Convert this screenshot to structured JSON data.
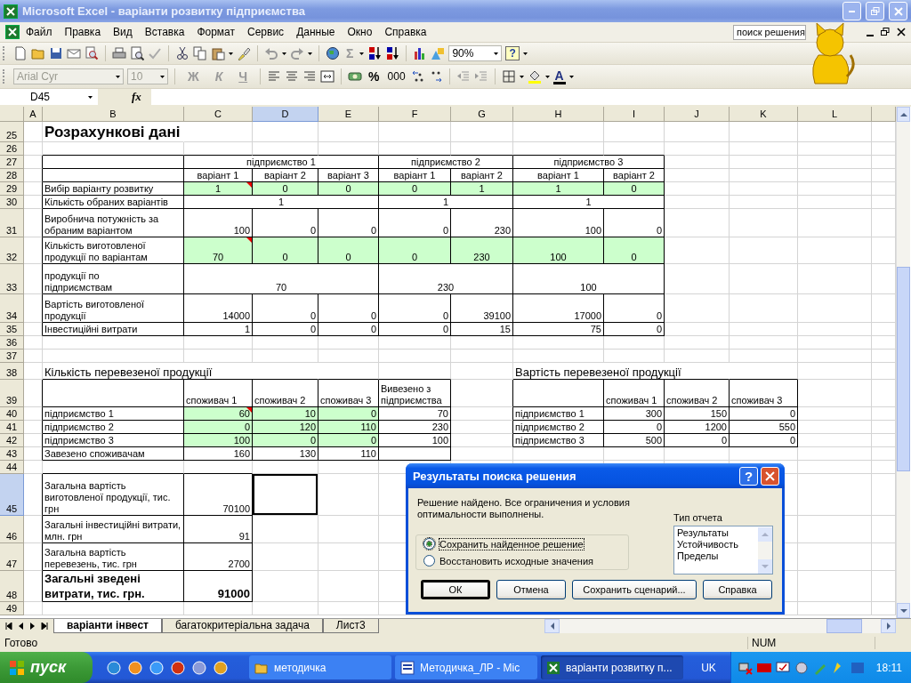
{
  "window": {
    "title": "Microsoft Excel - варіанти розвитку підприємства"
  },
  "menu": [
    "Файл",
    "Правка",
    "Вид",
    "Вставка",
    "Формат",
    "Сервис",
    "Данные",
    "Окно",
    "Справка"
  ],
  "help_search": {
    "value": "поиск решения"
  },
  "toolbar_standard": {
    "sum": "Σ",
    "zoom": "90%",
    "help": "?"
  },
  "toolbar_formatting": {
    "font": "Arial Cyr",
    "size": "10",
    "style_buttons": [
      "Ж",
      "К",
      "Ч"
    ],
    "percent": "%",
    "thousands": "000",
    "font_color": "A"
  },
  "formula_bar": {
    "name_box": "D45",
    "function_label": "fx"
  },
  "sheet": {
    "columns": [
      {
        "label": "A",
        "selected": false
      },
      {
        "label": "B",
        "selected": false
      },
      {
        "label": "C",
        "selected": false
      },
      {
        "label": "D",
        "selected": true
      },
      {
        "label": "E",
        "selected": false
      },
      {
        "label": "F",
        "selected": false
      },
      {
        "label": "G",
        "selected": false
      },
      {
        "label": "H",
        "selected": false
      },
      {
        "label": "I",
        "selected": false
      },
      {
        "label": "J",
        "selected": false
      },
      {
        "label": "K",
        "selected": false
      },
      {
        "label": "L",
        "selected": false
      }
    ],
    "rows": [
      {
        "number": "25",
        "selected": false,
        "cells": [
          {
            "kind": "title",
            "text": "Розрахункові дані"
          }
        ]
      },
      {
        "number": "26",
        "selected": false
      },
      {
        "number": "27",
        "selected": false,
        "cells": [
          {
            "kind": "centered",
            "text": "підприємство 1"
          },
          {
            "kind": "centered",
            "text": "підприємство 2"
          },
          {
            "kind": "centered",
            "text": "підприємство 3"
          }
        ]
      },
      {
        "number": "28",
        "selected": false,
        "cells": [
          {
            "kind": "centered",
            "text": "варіант 1"
          },
          {
            "kind": "centered",
            "text": "варіант 2"
          },
          {
            "kind": "centered",
            "text": "варіант 3"
          },
          {
            "kind": "centered",
            "text": "варіант 1"
          },
          {
            "kind": "centered",
            "text": "варіант 2"
          },
          {
            "kind": "centered",
            "text": "варіант 1"
          },
          {
            "kind": "centered",
            "text": "варіант 2"
          }
        ]
      },
      {
        "number": "29",
        "selected": false,
        "cells": [
          {
            "kind": "label",
            "text": "Вибір варіанту розвитку"
          },
          {
            "kind": "centered",
            "color": "#ccffcc",
            "comment": true,
            "text": "1"
          },
          {
            "kind": "centered",
            "color": "#ccffcc",
            "text": "0"
          },
          {
            "kind": "centered",
            "color": "#ccffcc",
            "text": "0"
          },
          {
            "kind": "centered",
            "color": "#ccffcc",
            "text": "0"
          },
          {
            "kind": "centered",
            "color": "#ccffcc",
            "text": "1"
          },
          {
            "kind": "centered",
            "color": "#ccffcc",
            "text": "1"
          },
          {
            "kind": "centered",
            "color": "#ccffcc",
            "text": "0"
          }
        ]
      },
      {
        "number": "30",
        "selected": false,
        "cells": [
          {
            "kind": "label",
            "text": "Кількість обраних варіантів"
          },
          {
            "kind": "centered",
            "text": "1"
          },
          {
            "kind": "centered",
            "text": "1"
          },
          {
            "kind": "centered",
            "text": "1"
          }
        ]
      },
      {
        "number": "31",
        "selected": false,
        "cells": [
          {
            "kind": "wrapped_label",
            "text": "Виробнича потужність за обраним варіантом"
          },
          {
            "kind": "number",
            "text": "100"
          },
          {
            "kind": "number",
            "text": "0"
          },
          {
            "kind": "number",
            "text": "0"
          },
          {
            "kind": "number",
            "text": "0"
          },
          {
            "kind": "number",
            "text": "230"
          },
          {
            "kind": "number",
            "text": "100"
          },
          {
            "kind": "number",
            "text": "0"
          }
        ]
      },
      {
        "number": "32",
        "selected": false,
        "cells": [
          {
            "kind": "wrapped_label",
            "text": "Кількість виготовленої продукції по варіантам"
          },
          {
            "kind": "centered",
            "color": "#ccffcc",
            "comment": true,
            "text": "70"
          },
          {
            "kind": "centered",
            "color": "#ccffcc",
            "text": "0"
          },
          {
            "kind": "centered",
            "color": "#ccffcc",
            "text": "0"
          },
          {
            "kind": "centered",
            "color": "#ccffcc",
            "text": "0"
          },
          {
            "kind": "centered",
            "color": "#ccffcc",
            "text": "230"
          },
          {
            "kind": "centered",
            "color": "#ccffcc",
            "text": "100"
          },
          {
            "kind": "centered",
            "color": "#ccffcc",
            "text": "0"
          }
        ]
      },
      {
        "number": "33",
        "selected": false,
        "cells": [
          {
            "kind": "wrapped_label",
            "text": "продукції по\nпідприємствам"
          },
          {
            "kind": "centered",
            "text": "70"
          },
          {
            "kind": "centered",
            "text": "230"
          },
          {
            "kind": "centered",
            "text": "100"
          }
        ]
      },
      {
        "number": "34",
        "selected": false,
        "cells": [
          {
            "kind": "wrapped_label",
            "text": "Вартість виготовленої продукції"
          },
          {
            "kind": "number",
            "text": "14000"
          },
          {
            "kind": "number",
            "text": "0"
          },
          {
            "kind": "number",
            "text": "0"
          },
          {
            "kind": "number",
            "text": "0"
          },
          {
            "kind": "number",
            "text": "39100"
          },
          {
            "kind": "number",
            "text": "17000"
          },
          {
            "kind": "number",
            "text": "0"
          }
        ]
      },
      {
        "number": "35",
        "selected": false,
        "cells": [
          {
            "kind": "label",
            "text": "Інвестиційні витрати"
          },
          {
            "kind": "number",
            "text": "1"
          },
          {
            "kind": "number",
            "text": "0"
          },
          {
            "kind": "number",
            "text": "0"
          },
          {
            "kind": "number",
            "text": "0"
          },
          {
            "kind": "number",
            "text": "15"
          },
          {
            "kind": "number",
            "text": "75"
          },
          {
            "kind": "number",
            "text": "0"
          }
        ]
      },
      {
        "number": "36",
        "selected": false
      },
      {
        "number": "37",
        "selected": false
      },
      {
        "number": "38",
        "selected": false,
        "cells": [
          {
            "kind": "caption",
            "text": "Кількість перевезеної продукції"
          },
          {
            "kind": "caption",
            "text": "Вартість перевезеної продукції"
          }
        ]
      },
      {
        "number": "39",
        "selected": false,
        "cells": [
          {
            "kind": "label",
            "text": "споживач 1"
          },
          {
            "kind": "label",
            "text": "споживач 2"
          },
          {
            "kind": "label",
            "text": "споживач 3"
          },
          {
            "kind": "wrapped_label",
            "text": "Вивезено з підприємства"
          },
          {
            "kind": "label",
            "text": "споживач 1"
          },
          {
            "kind": "label",
            "text": "споживач 2"
          },
          {
            "kind": "label",
            "text": "споживач 3"
          }
        ]
      },
      {
        "number": "40",
        "selected": false,
        "cells": [
          {
            "kind": "label",
            "text": "підприємство 1"
          },
          {
            "kind": "number",
            "color": "#ccffcc",
            "comment": true,
            "text": "60"
          },
          {
            "kind": "number",
            "color": "#ccffcc",
            "text": "10"
          },
          {
            "kind": "number",
            "color": "#ccffcc",
            "text": "0"
          },
          {
            "kind": "number",
            "text": "70"
          },
          {
            "kind": "label",
            "text": "підприємство 1"
          },
          {
            "kind": "number",
            "text": "300"
          },
          {
            "kind": "number",
            "text": "150"
          },
          {
            "kind": "number",
            "text": "0"
          }
        ]
      },
      {
        "number": "41",
        "selected": false,
        "cells": [
          {
            "kind": "label",
            "text": "підприємство 2"
          },
          {
            "kind": "number",
            "color": "#ccffcc",
            "text": "0"
          },
          {
            "kind": "number",
            "color": "#ccffcc",
            "text": "120"
          },
          {
            "kind": "number",
            "color": "#ccffcc",
            "text": "110"
          },
          {
            "kind": "number",
            "text": "230"
          },
          {
            "kind": "label",
            "text": "підприємство 2"
          },
          {
            "kind": "number",
            "text": "0"
          },
          {
            "kind": "number",
            "text": "1200"
          },
          {
            "kind": "number",
            "text": "550"
          }
        ]
      },
      {
        "number": "42",
        "selected": false,
        "cells": [
          {
            "kind": "label",
            "text": "підприємство 3"
          },
          {
            "kind": "number",
            "color": "#ccffcc",
            "text": "100"
          },
          {
            "kind": "number",
            "color": "#ccffcc",
            "text": "0"
          },
          {
            "kind": "number",
            "color": "#ccffcc",
            "text": "0"
          },
          {
            "kind": "number",
            "text": "100"
          },
          {
            "kind": "label",
            "text": "підприємство 3"
          },
          {
            "kind": "number",
            "text": "500"
          },
          {
            "kind": "number",
            "text": "0"
          },
          {
            "kind": "number",
            "text": "0"
          }
        ]
      },
      {
        "number": "43",
        "selected": false,
        "cells": [
          {
            "kind": "label",
            "text": "Завезено споживачам"
          },
          {
            "kind": "number",
            "text": "160"
          },
          {
            "kind": "number",
            "text": "130"
          },
          {
            "kind": "number",
            "text": "110"
          }
        ]
      },
      {
        "number": "44",
        "selected": false
      },
      {
        "number": "45",
        "selected": true,
        "cells": [
          {
            "kind": "wrapped_label",
            "text": "Загальна вартість виготовленої продукції, тис. грн"
          },
          {
            "kind": "number",
            "text": "70100"
          }
        ]
      },
      {
        "number": "46",
        "selected": false,
        "cells": [
          {
            "kind": "wrapped_label",
            "text": "Загальні інвестиційні витрати, млн. грн"
          },
          {
            "kind": "number",
            "text": "91"
          }
        ]
      },
      {
        "number": "47",
        "selected": false,
        "cells": [
          {
            "kind": "wrapped_label",
            "text": "Загальна вартість перевезень, тис. грн"
          },
          {
            "kind": "number",
            "text": "2700"
          }
        ]
      },
      {
        "number": "48",
        "selected": false,
        "cells": [
          {
            "kind": "bold_wrapped_label",
            "text": "Загальні зведені витрати, тис. грн."
          },
          {
            "kind": "bold_number",
            "text": "91000"
          }
        ]
      },
      {
        "number": "49",
        "selected": false
      }
    ]
  },
  "sheet_tabs": [
    {
      "label": "варіанти інвест",
      "selected": true
    },
    {
      "label": "багатокритеріальна задача",
      "selected": false
    },
    {
      "label": "Лист3",
      "selected": false
    }
  ],
  "status_bar": {
    "text": "Готово",
    "indicator": "NUM"
  },
  "dialog": {
    "title": "Результаты поиска решения",
    "help": "?",
    "message": "Решение найдено. Все ограничения и условия оптимальности выполнены.",
    "options": [
      {
        "label": "Сохранить найденное решение",
        "selected": true
      },
      {
        "label": "Восстановить исходные значения",
        "selected": false
      }
    ],
    "report_type": {
      "label": "Тип отчета",
      "items": [
        "Результаты",
        "Устойчивость",
        "Пределы"
      ]
    },
    "buttons": [
      {
        "label": "ОК",
        "default": true
      },
      {
        "label": "Отмена",
        "default": false
      },
      {
        "label": "Сохранить сценарий...",
        "default": false
      },
      {
        "label": "Справка",
        "default": false
      }
    ]
  },
  "taskbar": {
    "start": "пуск",
    "tasks": [
      {
        "kind": "folder",
        "label": "методичка",
        "selected": false
      },
      {
        "kind": "word",
        "label": "Методичка_ЛР - Mic",
        "selected": false
      },
      {
        "kind": "excel",
        "label": "варіанти розвитку п...",
        "selected": true
      }
    ],
    "language": "UK",
    "clock": "18:11"
  }
}
